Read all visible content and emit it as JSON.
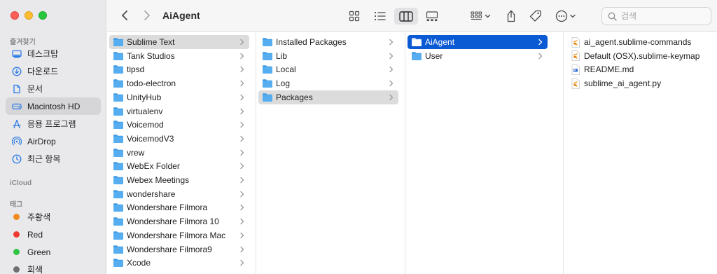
{
  "toolbar": {
    "title": "AiAgent",
    "search_placeholder": "검색"
  },
  "sidebar": {
    "favorites_label": "즐겨찾기",
    "favorites": [
      {
        "label": "데스크탑",
        "icon": "desktop-icon"
      },
      {
        "label": "다운로드",
        "icon": "download-icon"
      },
      {
        "label": "문서",
        "icon": "document-icon"
      },
      {
        "label": "Macintosh HD",
        "icon": "disk-icon",
        "selected": true
      },
      {
        "label": "응용 프로그램",
        "icon": "applications-icon"
      },
      {
        "label": "AirDrop",
        "icon": "airdrop-icon"
      },
      {
        "label": "최근 항목",
        "icon": "clock-icon"
      }
    ],
    "icloud_label": "iCloud",
    "tags_label": "태그",
    "tags": [
      {
        "label": "주황색",
        "color": "#f08a1c"
      },
      {
        "label": "Red",
        "color": "#ee3b30"
      },
      {
        "label": "Green",
        "color": "#2ec542"
      },
      {
        "label": "회색",
        "color": "#8e8e93"
      }
    ]
  },
  "columns": {
    "col1": [
      {
        "label": "Sublime Text",
        "selected": true
      },
      {
        "label": "Tank Studios"
      },
      {
        "label": "tipsd"
      },
      {
        "label": "todo-electron"
      },
      {
        "label": "UnityHub"
      },
      {
        "label": "virtualenv"
      },
      {
        "label": "Voicemod"
      },
      {
        "label": "VoicemodV3"
      },
      {
        "label": "vrew"
      },
      {
        "label": "WebEx Folder"
      },
      {
        "label": "Webex Meetings"
      },
      {
        "label": "wondershare"
      },
      {
        "label": "Wondershare Filmora"
      },
      {
        "label": "Wondershare Filmora 10"
      },
      {
        "label": "Wondershare Filmora Mac"
      },
      {
        "label": "Wondershare Filmora9"
      },
      {
        "label": "Xcode"
      }
    ],
    "col2": [
      {
        "label": "Installed Packages"
      },
      {
        "label": "Lib"
      },
      {
        "label": "Local"
      },
      {
        "label": "Log"
      },
      {
        "label": "Packages",
        "selected": true
      }
    ],
    "col3": [
      {
        "label": "AiAgent",
        "selected": true
      },
      {
        "label": "User"
      }
    ],
    "col4": [
      {
        "label": "ai_agent.sublime-commands",
        "type": "sublime"
      },
      {
        "label": "Default (OSX).sublime-keymap",
        "type": "sublime"
      },
      {
        "label": "README.md",
        "type": "md"
      },
      {
        "label": "sublime_ai_agent.py",
        "type": "sublime"
      }
    ]
  },
  "colors": {
    "selection_blue": "#0a5ad4",
    "folder_blue": "#56aef0"
  }
}
